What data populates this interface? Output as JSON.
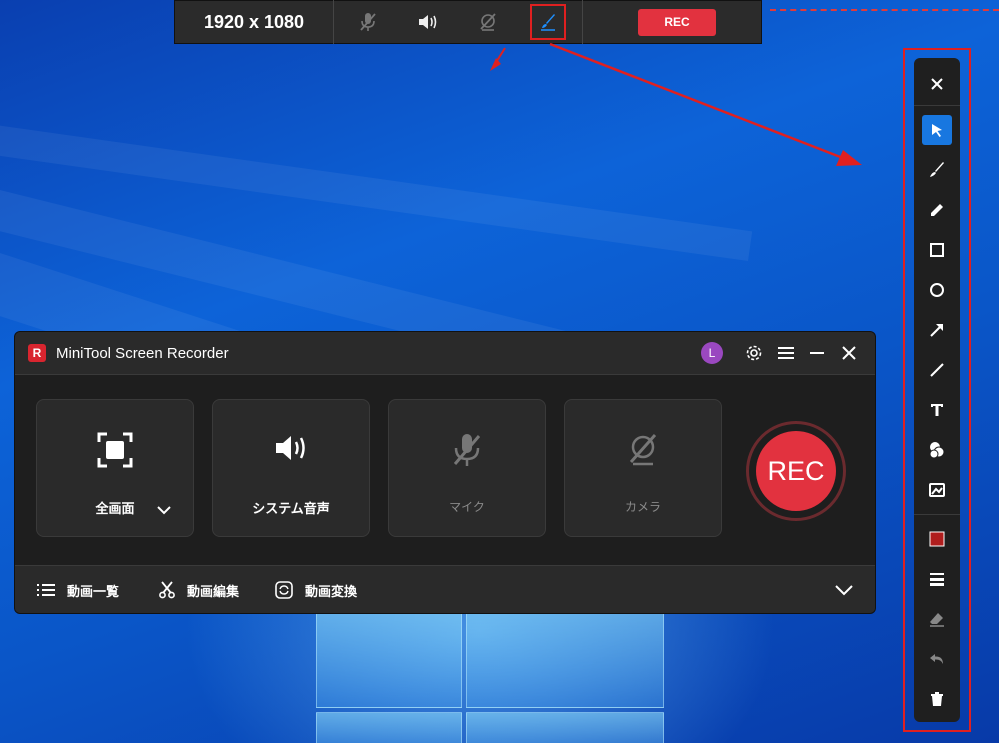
{
  "colors": {
    "accent_red": "#e2323f",
    "active_blue": "#1877e0",
    "highlight_red": "#e02020",
    "panel": "#2a2a2a",
    "desktop_blue": "#0d63d8"
  },
  "top_toolbar": {
    "resolution": "1920 x 1080",
    "icons": [
      "mic-off-icon",
      "speaker-icon",
      "camera-off-icon",
      "brush-icon"
    ],
    "rec_label": "REC"
  },
  "draw_toolbar": {
    "tools": [
      "close-icon",
      "select-arrow-icon",
      "brush-icon",
      "pencil-icon",
      "rectangle-icon",
      "circle-icon",
      "arrow-icon",
      "line-icon",
      "text-icon",
      "number-marker-icon",
      "highlight-icon",
      "color-swatch-icon",
      "line-weight-icon",
      "eraser-icon",
      "undo-icon",
      "delete-icon"
    ],
    "active_tool": "select-arrow-icon",
    "color": "#b01e1e"
  },
  "app": {
    "title": "MiniTool Screen Recorder",
    "avatar_letter": "L",
    "tiles": [
      {
        "label": "全画面",
        "icon": "fullscreen-icon"
      },
      {
        "label": "システム音声",
        "icon": "speaker-icon"
      },
      {
        "label": "マイク",
        "icon": "mic-off-icon"
      },
      {
        "label": "カメラ",
        "icon": "camera-off-icon"
      }
    ],
    "rec_label": "REC",
    "bottom": [
      {
        "label": "動画一覧",
        "icon": "list-icon"
      },
      {
        "label": "動画編集",
        "icon": "scissors-icon"
      },
      {
        "label": "動画変換",
        "icon": "convert-icon"
      }
    ]
  }
}
